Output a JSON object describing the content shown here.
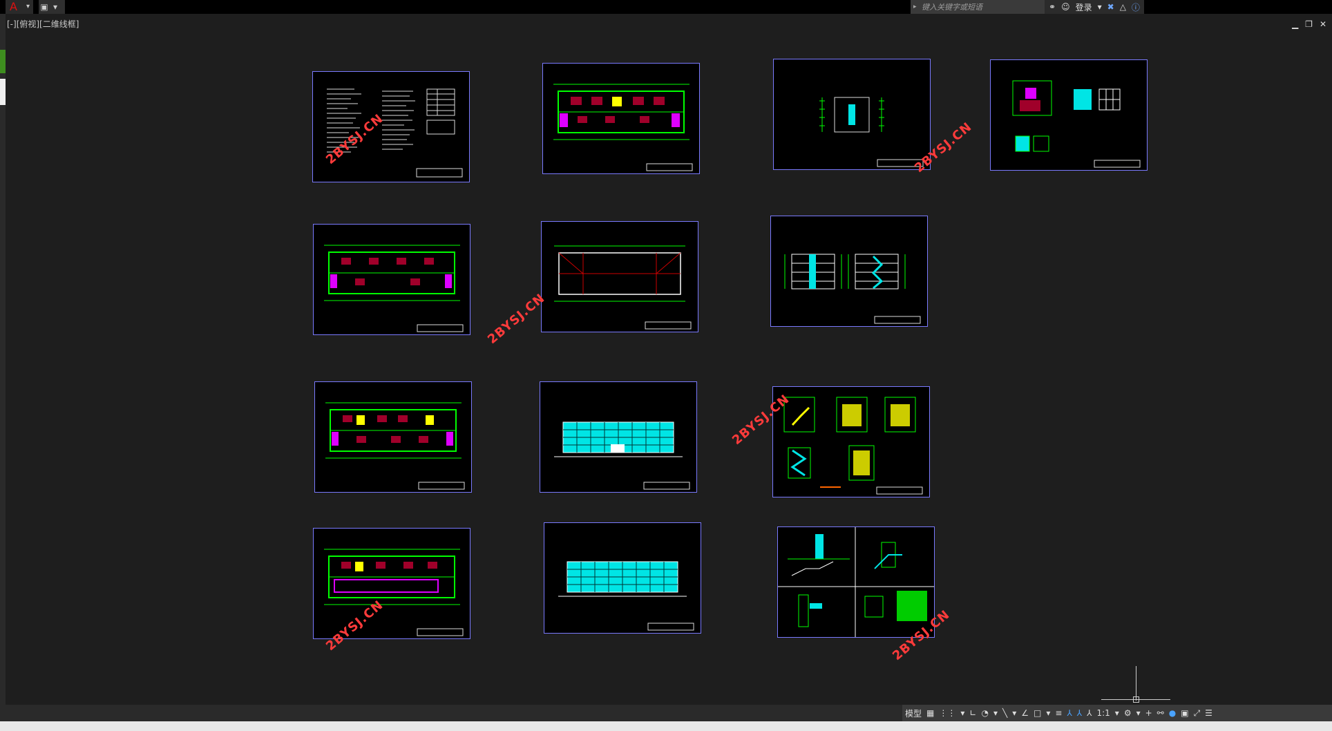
{
  "app": {
    "logo": "A",
    "search_placeholder": "键入关键字或短语",
    "login": "登录"
  },
  "viewport": {
    "label": "[-][俯视][二维线框]"
  },
  "watermark": "2BYSJ.CN",
  "statusbar": {
    "model_tab": "模型",
    "scale": "1:1"
  },
  "icons": {
    "app_menu": "autocad-logo-icon",
    "save": "save-icon",
    "binoculars": "binoculars-icon",
    "user": "user-icon",
    "exchange": "autodesk-exchange-icon",
    "help": "help-icon"
  },
  "colors": {
    "sheet_border": "#7a7aff",
    "wall": "#00ff00",
    "fill": "#00e5e5",
    "accent_red": "#ff3b3b"
  }
}
